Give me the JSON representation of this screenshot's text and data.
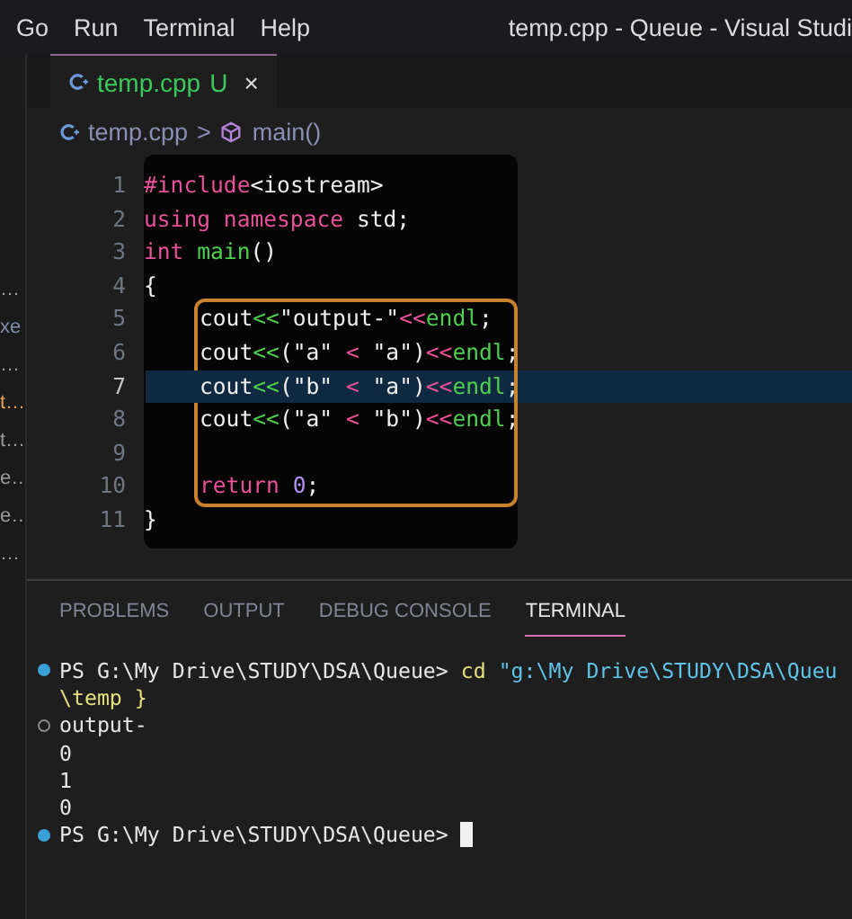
{
  "menu": [
    "Go",
    "Run",
    "Terminal",
    "Help"
  ],
  "window": {
    "title": "temp.cpp - Queue - Visual Studi"
  },
  "explorer": [
    {
      "label": "…",
      "color": "#9d9d9d"
    },
    {
      "label": "xe",
      "color": "#7f8fa6"
    },
    {
      "label": "…",
      "color": "#9d9d9d"
    },
    {
      "label": "t…",
      "color": "#e2a458"
    },
    {
      "label": "t…",
      "color": "#9d9d9d"
    },
    {
      "label": "e…",
      "color": "#9d9d9d"
    },
    {
      "label": "e…",
      "color": "#9d9d9d"
    },
    {
      "label": "…",
      "color": "#9d9d9d"
    }
  ],
  "tabs": [
    {
      "label": "temp.cpp",
      "badge": "U",
      "close": "×",
      "selected": true
    }
  ],
  "breadcrumb": {
    "file": "temp.cpp",
    "separator": ">",
    "symbol": "main()"
  },
  "code": [
    {
      "kind": "line",
      "number": "1",
      "current": false,
      "tokens": [
        {
          "text": "#include",
          "color": "#e9519b"
        },
        {
          "text": "<iostream>",
          "color": "#f0f0f0"
        }
      ]
    },
    {
      "kind": "line",
      "number": "2",
      "current": false,
      "tokens": [
        {
          "text": "using namespace ",
          "color": "#e9519b"
        },
        {
          "text": "std;",
          "color": "#f0f0f0"
        }
      ]
    },
    {
      "kind": "line",
      "number": "3",
      "current": false,
      "tokens": [
        {
          "text": "int ",
          "color": "#e9519b"
        },
        {
          "text": "main",
          "color": "#4ed04e"
        },
        {
          "text": "()",
          "color": "#f0f0f0"
        }
      ]
    },
    {
      "kind": "line",
      "number": "4",
      "current": false,
      "tokens": [
        {
          "text": "{",
          "color": "#f0f0f0"
        }
      ]
    },
    {
      "kind": "box",
      "lines": [
        {
          "number": "5",
          "current": false,
          "tokens": [
            {
              "text": "cout",
              "color": "#f0f0f0"
            },
            {
              "text": "<<",
              "color": "#4ed04e"
            },
            {
              "text": "\"output-\"",
              "color": "#f0f0f0"
            },
            {
              "text": "<<",
              "color": "#e9519b"
            },
            {
              "text": "endl",
              "color": "#4ed04e"
            },
            {
              "text": ";",
              "color": "#f0f0f0"
            }
          ]
        },
        {
          "number": "6",
          "current": false,
          "tokens": [
            {
              "text": "cout",
              "color": "#f0f0f0"
            },
            {
              "text": "<<",
              "color": "#4ed04e"
            },
            {
              "text": "(\"a\" ",
              "color": "#f0f0f0"
            },
            {
              "text": "<",
              "color": "#e9519b"
            },
            {
              "text": " \"a\")",
              "color": "#f0f0f0"
            },
            {
              "text": "<<",
              "color": "#e9519b"
            },
            {
              "text": "endl",
              "color": "#4ed04e"
            },
            {
              "text": ";",
              "color": "#f0f0f0"
            }
          ]
        },
        {
          "number": "7",
          "current": true,
          "tokens": [
            {
              "text": "cout",
              "color": "#f0f0f0"
            },
            {
              "text": "<<",
              "color": "#4ed04e"
            },
            {
              "text": "(\"b\" ",
              "color": "#f0f0f0"
            },
            {
              "text": "<",
              "color": "#e9519b"
            },
            {
              "text": " \"a\")",
              "color": "#f0f0f0"
            },
            {
              "text": "<<",
              "color": "#e9519b"
            },
            {
              "text": "endl",
              "color": "#4ed04e"
            },
            {
              "text": ";",
              "color": "#f0f0f0"
            }
          ]
        },
        {
          "number": "8",
          "current": false,
          "tokens": [
            {
              "text": "cout",
              "color": "#f0f0f0"
            },
            {
              "text": "<<",
              "color": "#4ed04e"
            },
            {
              "text": "(\"a\" ",
              "color": "#f0f0f0"
            },
            {
              "text": "<",
              "color": "#e9519b"
            },
            {
              "text": " \"b\")",
              "color": "#f0f0f0"
            },
            {
              "text": "<<",
              "color": "#e9519b"
            },
            {
              "text": "endl",
              "color": "#4ed04e"
            },
            {
              "text": ";",
              "color": "#f0f0f0"
            }
          ]
        },
        {
          "number": "9",
          "current": false
        },
        {
          "number": "10",
          "current": false,
          "tokens": [
            {
              "text": "return ",
              "color": "#e9519b"
            },
            {
              "text": "0",
              "color": "#b48ef0"
            },
            {
              "text": ";",
              "color": "#f0f0f0"
            }
          ]
        }
      ]
    },
    {
      "kind": "line",
      "number": "11",
      "current": false,
      "tokens": [
        {
          "text": "}",
          "color": "#f0f0f0"
        }
      ]
    }
  ],
  "panel_tabs": [
    {
      "label": "PROBLEMS",
      "selected": false
    },
    {
      "label": "OUTPUT",
      "selected": false
    },
    {
      "label": "DEBUG CONSOLE",
      "selected": false
    },
    {
      "label": "TERMINAL",
      "selected": true
    }
  ],
  "terminal": [
    {
      "kind": "command",
      "parts": [
        {
          "text": "PS G:\\My Drive\\STUDY\\DSA\\Queue> ",
          "color": "#e6e6e6"
        },
        {
          "text": "cd ",
          "color": "#e5e07a"
        },
        {
          "text": "\"g:\\My Drive\\STUDY\\DSA\\Queu",
          "color": "#5fc4e8"
        }
      ]
    },
    {
      "kind": "continuation",
      "parts": [
        {
          "text": "\\temp }",
          "color": "#e5e07a"
        }
      ]
    },
    {
      "kind": "output",
      "parts": [
        {
          "text": "output-",
          "color": "#e6e6e6"
        }
      ]
    },
    {
      "kind": "continuation",
      "parts": [
        {
          "text": "0",
          "color": "#e6e6e6"
        }
      ]
    },
    {
      "kind": "continuation",
      "parts": [
        {
          "text": "1",
          "color": "#e6e6e6"
        }
      ]
    },
    {
      "kind": "continuation",
      "parts": [
        {
          "text": "0",
          "color": "#e6e6e6"
        }
      ]
    },
    {
      "kind": "prompt",
      "parts": [
        {
          "text": "PS G:\\My Drive\\STUDY\\DSA\\Queue> ",
          "color": "#e6e6e6"
        }
      ]
    }
  ]
}
